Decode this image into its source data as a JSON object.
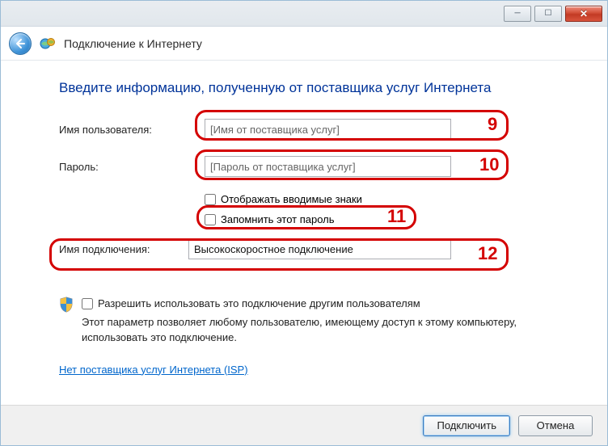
{
  "window": {
    "minimize_glyph": "─",
    "maximize_glyph": "☐",
    "close_glyph": "✕"
  },
  "header": {
    "title": "Подключение к Интернету"
  },
  "page": {
    "heading": "Введите информацию, полученную от поставщика услуг Интернета"
  },
  "form": {
    "username_label": "Имя пользователя:",
    "username_placeholder": "[Имя от поставщика услуг]",
    "password_label": "Пароль:",
    "password_placeholder": "[Пароль от поставщика услуг]",
    "show_chars_label": "Отображать вводимые знаки",
    "remember_label": "Запомнить этот пароль",
    "connection_name_label": "Имя подключения:",
    "connection_name_value": "Высокоскоростное подключение"
  },
  "allow": {
    "checkbox_label": "Разрешить использовать это подключение другим пользователям",
    "description": "Этот параметр позволяет любому пользователю, имеющему доступ к этому компьютеру, использовать это подключение."
  },
  "isp_link": "Нет поставщика услуг Интернета (ISP)",
  "buttons": {
    "connect": "Подключить",
    "cancel": "Отмена"
  },
  "annotations": {
    "n9": "9",
    "n10": "10",
    "n11": "11",
    "n12": "12"
  }
}
